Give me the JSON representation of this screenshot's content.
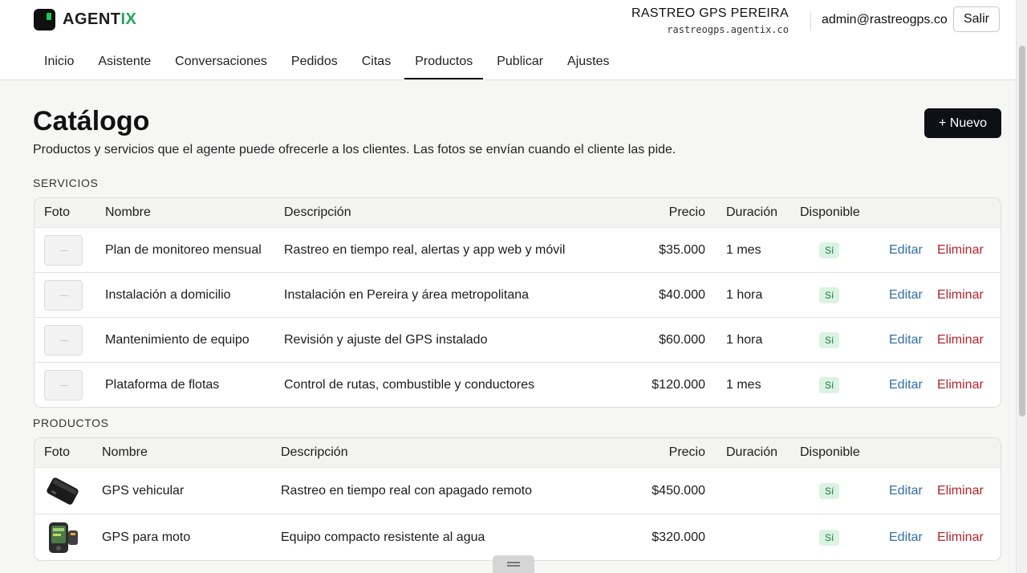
{
  "brand": {
    "name_prefix": "AGENT",
    "name_suffix": "IX",
    "accent": "#22a45a"
  },
  "account": {
    "business_name": "RASTREO GPS PEREIRA",
    "domain": "rastreogps.agentix.co",
    "email": "admin@rastreogps.co",
    "logout_label": "Salir"
  },
  "nav": {
    "items": [
      {
        "label": "Inicio"
      },
      {
        "label": "Asistente"
      },
      {
        "label": "Conversaciones"
      },
      {
        "label": "Pedidos"
      },
      {
        "label": "Citas"
      },
      {
        "label": "Productos",
        "active": true
      },
      {
        "label": "Publicar"
      },
      {
        "label": "Ajustes"
      }
    ]
  },
  "page": {
    "title": "Catálogo",
    "subtitle": "Productos y servicios que el agente puede ofrecerle a los clientes. Las fotos se envían cuando el cliente las pide.",
    "new_button": "+ Nuevo"
  },
  "columns": {
    "photo": "Foto",
    "name": "Nombre",
    "description": "Descripción",
    "price": "Precio",
    "duration": "Duración",
    "available": "Disponible"
  },
  "actions": {
    "edit": "Editar",
    "delete": "Eliminar"
  },
  "services": {
    "label": "SERVICIOS",
    "rows": [
      {
        "name": "Plan de monitoreo mensual",
        "description": "Rastreo en tiempo real, alertas y app web y móvil",
        "price": "$35.000",
        "duration": "1 mes",
        "available": "Sí"
      },
      {
        "name": "Instalación a domicilio",
        "description": "Instalación en Pereira y área metropolitana",
        "price": "$40.000",
        "duration": "1 hora",
        "available": "Sí"
      },
      {
        "name": "Mantenimiento de equipo",
        "description": "Revisión y ajuste del GPS instalado",
        "price": "$60.000",
        "duration": "1 hora",
        "available": "Sí"
      },
      {
        "name": "Plataforma de flotas",
        "description": "Control de rutas, combustible y conductores",
        "price": "$120.000",
        "duration": "1 mes",
        "available": "Sí"
      }
    ]
  },
  "products": {
    "label": "PRODUCTOS",
    "rows": [
      {
        "name": "GPS vehicular",
        "description": "Rastreo en tiempo real con apagado remoto",
        "price": "$450.000",
        "duration": "",
        "available": "Sí",
        "photo_icon": "gps-vehicle-device-icon"
      },
      {
        "name": "GPS para moto",
        "description": "Equipo compacto resistente al agua",
        "price": "$320.000",
        "duration": "",
        "available": "Sí",
        "photo_icon": "gps-moto-device-icon"
      }
    ]
  }
}
